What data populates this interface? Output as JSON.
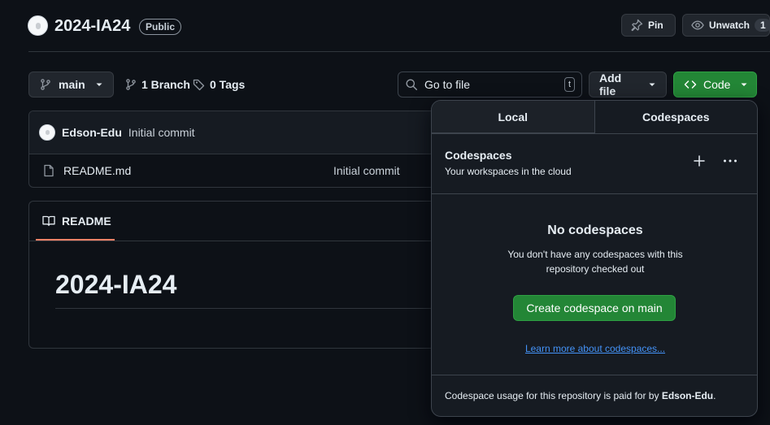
{
  "repo": {
    "name": "2024-IA24",
    "visibility": "Public",
    "pin_label": "Pin",
    "watch_label": "Unwatch",
    "watch_count": "1"
  },
  "toolbar": {
    "branch": "main",
    "branches_label": "1 Branch",
    "tags_label": "0 Tags",
    "search_placeholder": "Go to file",
    "search_shortcut": "t",
    "add_file_label": "Add file",
    "code_label": "Code"
  },
  "commit": {
    "author": "Edson-Edu",
    "message": "Initial commit"
  },
  "files": [
    {
      "name": "README.md",
      "commit_message": "Initial commit"
    }
  ],
  "readme": {
    "tab_label": "README",
    "heading": "2024-IA24"
  },
  "code_dropdown": {
    "tabs": [
      "Local",
      "Codespaces"
    ],
    "active_tab": "Codespaces",
    "section_title": "Codespaces",
    "section_subtitle": "Your workspaces in the cloud",
    "empty_title": "No codespaces",
    "empty_line1": "You don't have any codespaces with this",
    "empty_line2": "repository checked out",
    "create_button": "Create codespace on main",
    "learn_link": "Learn more about codespaces...",
    "footer_prefix": "Codespace usage for this repository is paid for by ",
    "footer_owner": "Edson-Edu",
    "footer_suffix": "."
  },
  "colors": {
    "background": "#0d1117",
    "green": "#238636",
    "link": "#4493f8",
    "accent_underline": "#f78166"
  }
}
